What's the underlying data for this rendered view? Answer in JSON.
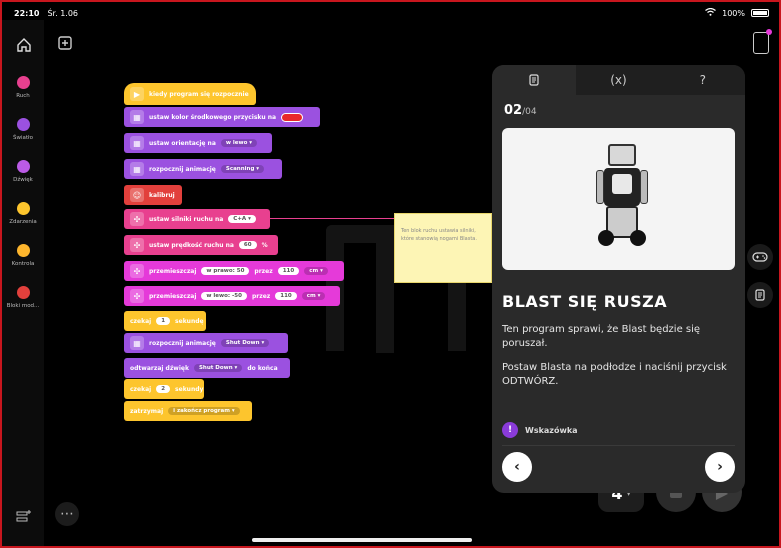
{
  "status_bar": {
    "time": "22:10",
    "date": "Śr. 1.06",
    "battery": "100%"
  },
  "categories": [
    {
      "label": "Ruch",
      "color": "#e8408f"
    },
    {
      "label": "Światło",
      "color": "#9b51e0"
    },
    {
      "label": "Dźwięk",
      "color": "#bb5be6"
    },
    {
      "label": "Zdarzenia",
      "color": "#fdc52d"
    },
    {
      "label": "Kontrola",
      "color": "#fdb52d"
    },
    {
      "label": "Bloki mod...",
      "color": "#e2403c"
    }
  ],
  "blocks": {
    "b1": "kiedy program się rozpocznie",
    "b2": "ustaw kolor środkowego przycisku na",
    "b3": "ustaw orientację na",
    "b3_val": "w lewo ▾",
    "b4": "rozpocznij animację",
    "b4_val": "Scanning ▾",
    "b5": "kalibruj",
    "b6": "ustaw silniki ruchu na",
    "b6_val": "C+A ▾",
    "b7": "ustaw prędkość ruchu na",
    "b7_val": "60",
    "b7_unit": "%",
    "b8": "przemieszczaj",
    "b8_val": "w prawo: 50",
    "b8_mid": "przez",
    "b8_num": "110",
    "b8_unit": "cm ▾",
    "b9": "przemieszczaj",
    "b9_val": "w lewo: -50",
    "b9_mid": "przez",
    "b9_num": "110",
    "b9_unit": "cm ▾",
    "b10": "czekaj",
    "b10_val": "1",
    "b10_unit": "sekundę",
    "b11": "rozpocznij animację",
    "b11_val": "Shut Down ▾",
    "b12": "odtwarzaj dźwięk",
    "b12_val": "Shut Down ▾",
    "b12_end": "do końca",
    "b13": "czekaj",
    "b13_val": "2",
    "b13_unit": "sekundy",
    "b14": "zatrzymaj",
    "b14_val": "i zakończ program ▾"
  },
  "comment": "Ten blok ruchu ustawia silniki, które stanowią nogami Blasta.",
  "slot": {
    "number": "4",
    "chevron": "▾"
  },
  "panel": {
    "tabs": [
      "▤",
      "(x)",
      "?"
    ],
    "step_current": "02",
    "step_total": "/04",
    "title": "BLAST SIĘ RUSZA",
    "desc1": "Ten program sprawi, że Blast będzie się poruszał.",
    "desc2": "Postaw Blasta na podłodze i naciśnij przycisk ODTWÓRZ.",
    "hint_label": "Wskazówka",
    "prev": "‹",
    "next": "›"
  },
  "icons": {
    "home": "home-icon",
    "add": "add-icon",
    "device": "device-icon",
    "gamepad": "gamepad-icon",
    "notes": "notes-icon",
    "more": "more-icon"
  }
}
